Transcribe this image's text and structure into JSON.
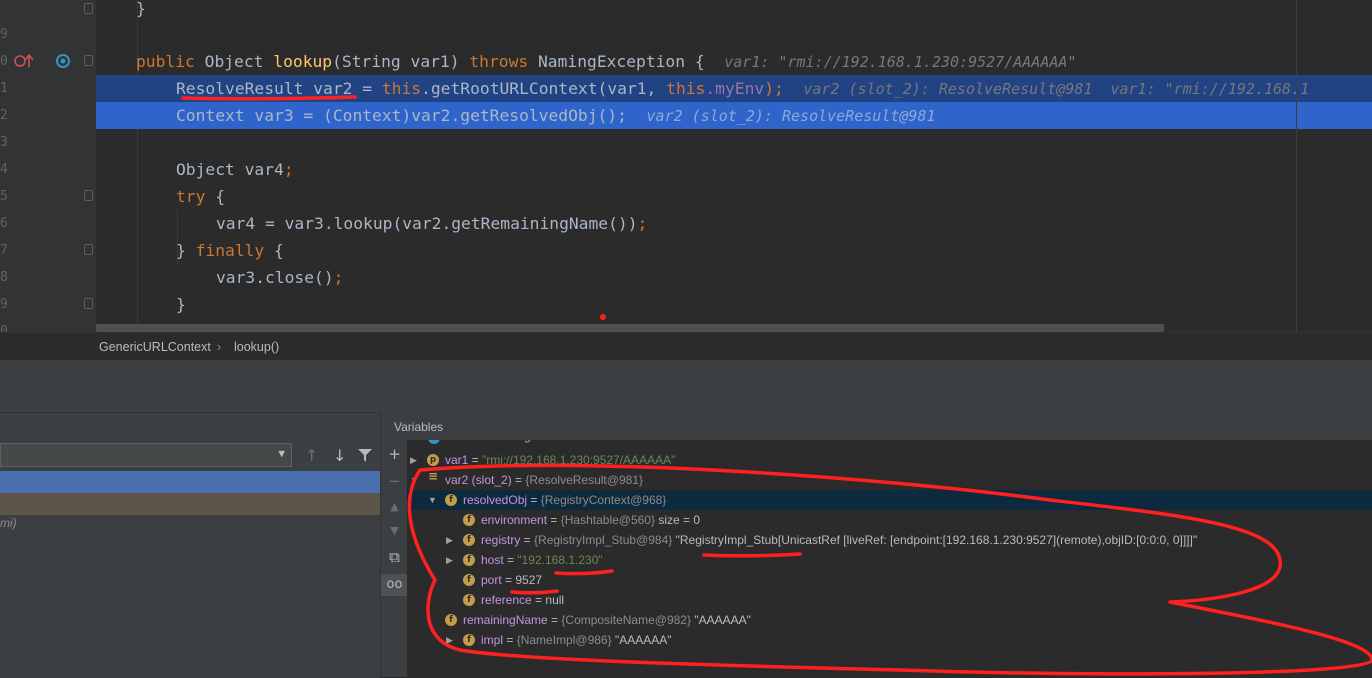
{
  "editor": {
    "line_numbers": [
      "",
      "9",
      "0",
      "1",
      "2",
      "3",
      "4",
      "5",
      "6",
      "7",
      "8",
      "9",
      "0"
    ],
    "lines": {
      "close_brace": "}",
      "l_lookup": {
        "kw": "public",
        "type": "Object",
        "method": "lookup",
        "args": "(String var1)",
        "throws": "throws",
        "exc": "NamingException {",
        "hint": "var1: \"rmi://192.168.1.230:9527/AAAAAA\""
      },
      "l_var2": {
        "decl": "ResolveResult var2 = ",
        "this1": "this",
        "call": ".getRootURLContext(var1, ",
        "this2": "this",
        "field": ".myEnv",
        "end": ");",
        "hint": "var2 (slot_2): ResolveResult@981  var1: \"rmi://192.168.1"
      },
      "l_var3": {
        "code": "Context var3 = (Context)var2.getResolvedObj();",
        "hint": "var2 (slot_2): ResolveResult@981"
      },
      "l_var4": {
        "code": "Object var4",
        "semi": ";"
      },
      "l_try": {
        "kw": "try",
        "rest": " {"
      },
      "l_assign": {
        "code": "var4 = var3.lookup(var2.getRemainingName())",
        "semi": ";"
      },
      "l_finally": {
        "open": "} ",
        "kw": "finally",
        "rest": " {"
      },
      "l_close": {
        "code": "var3.close()",
        "semi": ";"
      },
      "l_brace2": "}"
    }
  },
  "breadcrumb": {
    "class_name": "GenericURLContext",
    "method_name": "lookup()"
  },
  "frames": {
    "partial_item": "mi)"
  },
  "variables": {
    "title": "Variables",
    "rows": [
      {
        "name": "Variables debug info not available",
        "eq": "",
        "type": "",
        "value": ""
      },
      {
        "name": "var1",
        "eq": " = ",
        "type": "",
        "value": "\"rmi://192.168.1.230:9527/AAAAAA\""
      },
      {
        "name": "var2 (slot_2)",
        "eq": " = ",
        "type": "{ResolveResult@981}",
        "value": ""
      },
      {
        "name": "resolvedObj",
        "eq": " = ",
        "type": "{RegistryContext@968}",
        "value": ""
      },
      {
        "name": "environment",
        "eq": " = ",
        "type": "{Hashtable@560}",
        "value": "  size = 0"
      },
      {
        "name": "registry",
        "eq": " = ",
        "type": "{RegistryImpl_Stub@984}",
        "value": " \"RegistryImpl_Stub[UnicastRef [liveRef: [endpoint:[192.168.1.230:9527](remote),objID:[0:0:0, 0]]]]\""
      },
      {
        "name": "host",
        "eq": " = ",
        "type": "",
        "value": "\"192.168.1.230\""
      },
      {
        "name": "port",
        "eq": " = ",
        "type": "",
        "value": "9527"
      },
      {
        "name": "reference",
        "eq": " = ",
        "type": "",
        "value": "null"
      },
      {
        "name": "remainingName",
        "eq": " = ",
        "type": "{CompositeName@982}",
        "value": " \"AAAAAA\""
      },
      {
        "name": "impl",
        "eq": " = ",
        "type": "{NameImpl@986}",
        "value": " \"AAAAAA\""
      }
    ]
  },
  "colors": {
    "annotation": "#ff2020",
    "selection": "#2f65ca",
    "frame_selected": "#4b6eaf"
  }
}
